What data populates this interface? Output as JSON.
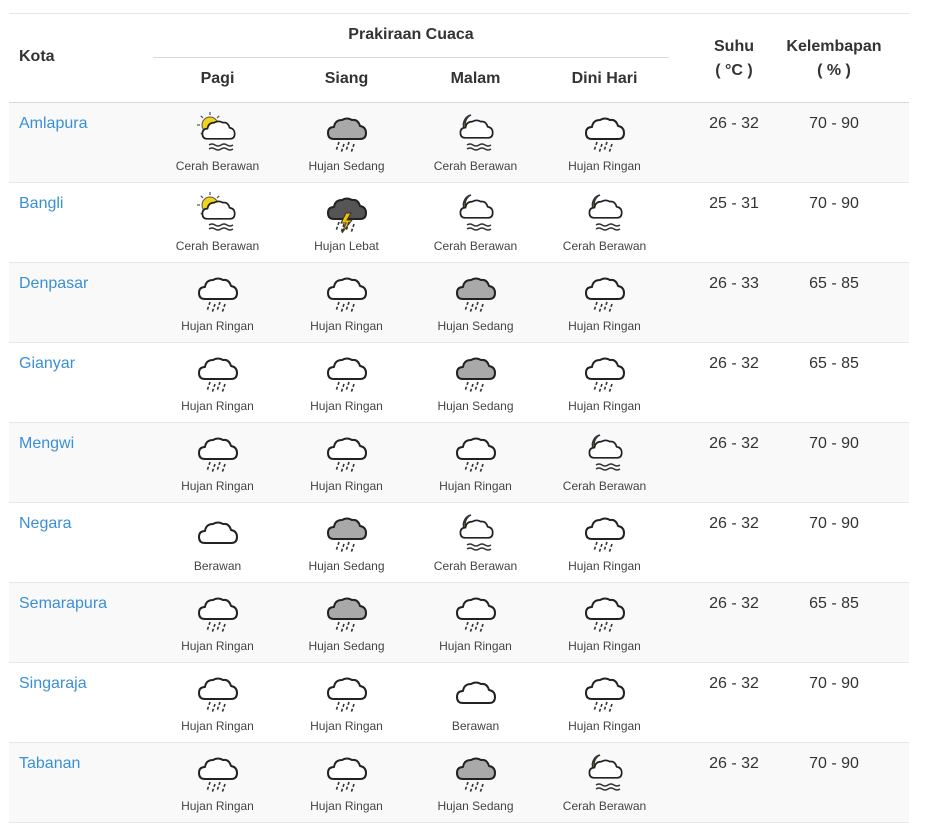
{
  "header": {
    "kota": "Kota",
    "prakiraan": "Prakiraan Cuaca",
    "periods": [
      "Pagi",
      "Siang",
      "Malam",
      "Dini Hari"
    ],
    "suhu_line1": "Suhu",
    "suhu_line2": "( °C )",
    "kelembapan_line1": "Kelembapan",
    "kelembapan_line2": "( % )"
  },
  "icons": {
    "Cerah Berawan day": "partly-cloudy-sun-icon",
    "Cerah Berawan night": "partly-cloudy-moon-icon",
    "Berawan": "cloud-icon",
    "Hujan Ringan": "light-rain-icon",
    "Hujan Sedang": "moderate-rain-icon",
    "Hujan Lebat": "thunderstorm-icon"
  },
  "rows": [
    {
      "city": "Amlapura",
      "forecast": [
        {
          "label": "Cerah Berawan",
          "icon": "sun-cloud"
        },
        {
          "label": "Hujan Sedang",
          "icon": "rain-medium"
        },
        {
          "label": "Cerah Berawan",
          "icon": "moon-cloud"
        },
        {
          "label": "Hujan Ringan",
          "icon": "rain-light"
        }
      ],
      "suhu": "26 - 32",
      "kelembapan": "70 - 90"
    },
    {
      "city": "Bangli",
      "forecast": [
        {
          "label": "Cerah Berawan",
          "icon": "sun-cloud"
        },
        {
          "label": "Hujan Lebat",
          "icon": "storm"
        },
        {
          "label": "Cerah Berawan",
          "icon": "moon-cloud"
        },
        {
          "label": "Cerah Berawan",
          "icon": "moon-cloud"
        }
      ],
      "suhu": "25 - 31",
      "kelembapan": "70 - 90"
    },
    {
      "city": "Denpasar",
      "forecast": [
        {
          "label": "Hujan Ringan",
          "icon": "rain-light"
        },
        {
          "label": "Hujan Ringan",
          "icon": "rain-light"
        },
        {
          "label": "Hujan Sedang",
          "icon": "rain-medium"
        },
        {
          "label": "Hujan Ringan",
          "icon": "rain-light"
        }
      ],
      "suhu": "26 - 33",
      "kelembapan": "65 - 85"
    },
    {
      "city": "Gianyar",
      "forecast": [
        {
          "label": "Hujan Ringan",
          "icon": "rain-light"
        },
        {
          "label": "Hujan Ringan",
          "icon": "rain-light"
        },
        {
          "label": "Hujan Sedang",
          "icon": "rain-medium"
        },
        {
          "label": "Hujan Ringan",
          "icon": "rain-light"
        }
      ],
      "suhu": "26 - 32",
      "kelembapan": "65 - 85"
    },
    {
      "city": "Mengwi",
      "forecast": [
        {
          "label": "Hujan Ringan",
          "icon": "rain-light"
        },
        {
          "label": "Hujan Ringan",
          "icon": "rain-light"
        },
        {
          "label": "Hujan Ringan",
          "icon": "rain-light"
        },
        {
          "label": "Cerah Berawan",
          "icon": "moon-cloud"
        }
      ],
      "suhu": "26 - 32",
      "kelembapan": "70 - 90"
    },
    {
      "city": "Negara",
      "forecast": [
        {
          "label": "Berawan",
          "icon": "cloud"
        },
        {
          "label": "Hujan Sedang",
          "icon": "rain-medium"
        },
        {
          "label": "Cerah Berawan",
          "icon": "moon-cloud"
        },
        {
          "label": "Hujan Ringan",
          "icon": "rain-light"
        }
      ],
      "suhu": "26 - 32",
      "kelembapan": "70 - 90"
    },
    {
      "city": "Semarapura",
      "forecast": [
        {
          "label": "Hujan Ringan",
          "icon": "rain-light"
        },
        {
          "label": "Hujan Sedang",
          "icon": "rain-medium"
        },
        {
          "label": "Hujan Ringan",
          "icon": "rain-light"
        },
        {
          "label": "Hujan Ringan",
          "icon": "rain-light"
        }
      ],
      "suhu": "26 - 32",
      "kelembapan": "65 - 85"
    },
    {
      "city": "Singaraja",
      "forecast": [
        {
          "label": "Hujan Ringan",
          "icon": "rain-light"
        },
        {
          "label": "Hujan Ringan",
          "icon": "rain-light"
        },
        {
          "label": "Berawan",
          "icon": "cloud"
        },
        {
          "label": "Hujan Ringan",
          "icon": "rain-light"
        }
      ],
      "suhu": "26 - 32",
      "kelembapan": "70 - 90"
    },
    {
      "city": "Tabanan",
      "forecast": [
        {
          "label": "Hujan Ringan",
          "icon": "rain-light"
        },
        {
          "label": "Hujan Ringan",
          "icon": "rain-light"
        },
        {
          "label": "Hujan Sedang",
          "icon": "rain-medium"
        },
        {
          "label": "Cerah Berawan",
          "icon": "moon-cloud"
        }
      ],
      "suhu": "26 - 32",
      "kelembapan": "70 - 90"
    }
  ],
  "colors": {
    "link": "#3a8fd6",
    "text": "#333333",
    "row_alt": "#f9f9f9",
    "sun": "#f3d21a",
    "moon": "#f0d000",
    "cloud_gray": "#a9a9a9",
    "lightning": "#f2c200"
  }
}
